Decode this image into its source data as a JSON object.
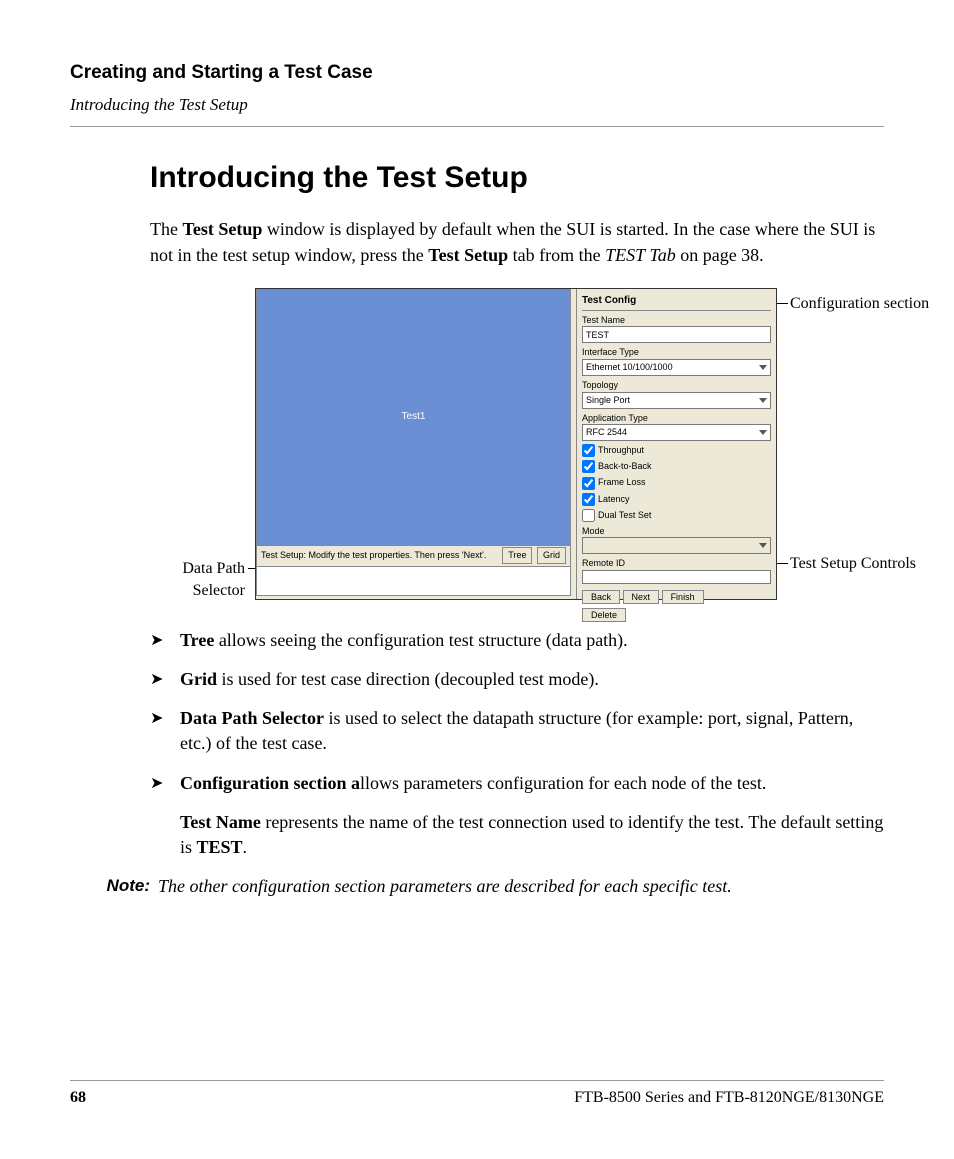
{
  "header": {
    "chapter": "Creating and Starting a Test Case",
    "subsection": "Introducing the Test Setup"
  },
  "section_title": "Introducing the Test Setup",
  "intro": {
    "p1a": "The ",
    "p1b": "Test Setup",
    "p1c": " window is displayed by default when the SUI is started. In the case where the SUI is not in the test setup window, press the ",
    "p1d": "Test Setup",
    "p1e": " tab from the ",
    "p1f": "TEST Tab",
    "p1g": " on page 38."
  },
  "callouts": {
    "config_section": "Configuration section",
    "data_path_selector": "Data Path Selector",
    "test_setup_controls": "Test Setup Controls"
  },
  "screenshot": {
    "canvas_label": "Test1",
    "hint": "Test Setup: Modify the test properties. Then press 'Next'.",
    "btn_tree": "Tree",
    "btn_grid": "Grid",
    "config_title": "Test Config",
    "lbl_test_name": "Test Name",
    "val_test_name": "TEST",
    "lbl_iface": "Interface Type",
    "val_iface": "Ethernet 10/100/1000",
    "lbl_topology": "Topology",
    "val_topology": "Single Port",
    "lbl_apptype": "Application Type",
    "val_apptype": "RFC 2544",
    "chk_throughput": "Throughput",
    "chk_b2b": "Back-to-Back",
    "chk_frameloss": "Frame Loss",
    "chk_latency": "Latency",
    "chk_dual": "Dual Test Set",
    "lbl_mode": "Mode",
    "lbl_remoteid": "Remote ID",
    "btn_back": "Back",
    "btn_next": "Next",
    "btn_finish": "Finish",
    "btn_delete": "Delete"
  },
  "bullets": {
    "tree_b": "Tree",
    "tree_t": " allows seeing the configuration test structure (data path).",
    "grid_b": "Grid",
    "grid_t": " is used for test case direction (decoupled test mode).",
    "dps_b": "Data Path Selector",
    "dps_t": " is used to select the datapath structure (for example: port, signal, Pattern, etc.) of the test case.",
    "cfg_b": "Configuration section a",
    "cfg_t": "llows parameters configuration for each node of the test.",
    "tn_b": "Test Name",
    "tn_t1": " represents the name of the test connection used to identify the test. The default setting is ",
    "tn_t2": "TEST",
    "tn_t3": "."
  },
  "note": {
    "label": "Note:",
    "text": "The other configuration section parameters are described for each specific test."
  },
  "footer": {
    "page": "68",
    "product": "FTB-8500 Series and FTB-8120NGE/8130NGE"
  }
}
